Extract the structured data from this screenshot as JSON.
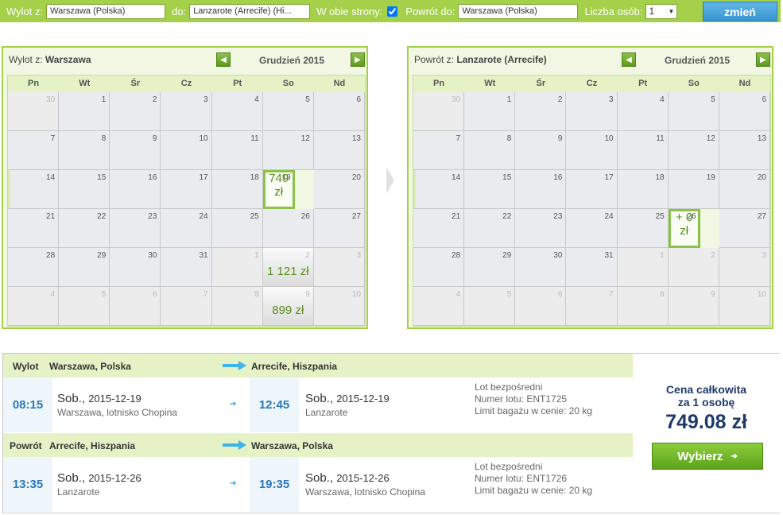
{
  "search": {
    "from_label": "Wylot z:",
    "from_value": "Warszawa (Polska)",
    "to_label": "do:",
    "to_value": "Lanzarote (Arrecife) (Hi...",
    "both_label": "W obie strony:",
    "return_label": "Powrót do:",
    "return_value": "Warszawa (Polska)",
    "people_label": "Liczba osób:",
    "people_value": "1",
    "button": "zmień"
  },
  "calendar_out": {
    "title_prefix": "Wylot z:",
    "title_city": "Warszawa",
    "month": "Grudzień 2015",
    "days": [
      "Pn",
      "Wt",
      "Śr",
      "Cz",
      "Pt",
      "So",
      "Nd"
    ],
    "cells": [
      {
        "d": "30",
        "out": true
      },
      {
        "d": "1"
      },
      {
        "d": "2"
      },
      {
        "d": "3"
      },
      {
        "d": "4"
      },
      {
        "d": "5"
      },
      {
        "d": "6"
      },
      {
        "d": "7"
      },
      {
        "d": "8"
      },
      {
        "d": "9"
      },
      {
        "d": "10"
      },
      {
        "d": "11"
      },
      {
        "d": "12"
      },
      {
        "d": "13"
      },
      {
        "d": "14"
      },
      {
        "d": "15"
      },
      {
        "d": "16"
      },
      {
        "d": "17"
      },
      {
        "d": "18"
      },
      {
        "d": "19",
        "price": "749 zł",
        "sel": true
      },
      {
        "d": "20"
      },
      {
        "d": "21"
      },
      {
        "d": "22"
      },
      {
        "d": "23"
      },
      {
        "d": "24"
      },
      {
        "d": "25"
      },
      {
        "d": "26"
      },
      {
        "d": "27"
      },
      {
        "d": "28"
      },
      {
        "d": "29"
      },
      {
        "d": "30"
      },
      {
        "d": "31"
      },
      {
        "d": "1",
        "out": true
      },
      {
        "d": "2",
        "out": true,
        "price": "1 121 zł",
        "grad": true
      },
      {
        "d": "3",
        "out": true
      },
      {
        "d": "4",
        "out": true
      },
      {
        "d": "5",
        "out": true
      },
      {
        "d": "6",
        "out": true
      },
      {
        "d": "7",
        "out": true
      },
      {
        "d": "8",
        "out": true
      },
      {
        "d": "9",
        "out": true,
        "price": "899 zł",
        "grad": true
      },
      {
        "d": "10",
        "out": true
      }
    ]
  },
  "calendar_ret": {
    "title_prefix": "Powrót z:",
    "title_city": "Lanzarote (Arrecife)",
    "month": "Grudzień 2015",
    "days": [
      "Pn",
      "Wt",
      "Śr",
      "Cz",
      "Pt",
      "So",
      "Nd"
    ],
    "cells": [
      {
        "d": "30",
        "out": true
      },
      {
        "d": "1"
      },
      {
        "d": "2"
      },
      {
        "d": "3"
      },
      {
        "d": "4"
      },
      {
        "d": "5"
      },
      {
        "d": "6"
      },
      {
        "d": "7"
      },
      {
        "d": "8"
      },
      {
        "d": "9"
      },
      {
        "d": "10"
      },
      {
        "d": "11"
      },
      {
        "d": "12"
      },
      {
        "d": "13"
      },
      {
        "d": "14"
      },
      {
        "d": "15"
      },
      {
        "d": "16"
      },
      {
        "d": "17"
      },
      {
        "d": "18"
      },
      {
        "d": "19"
      },
      {
        "d": "20"
      },
      {
        "d": "21"
      },
      {
        "d": "22"
      },
      {
        "d": "23"
      },
      {
        "d": "24"
      },
      {
        "d": "25"
      },
      {
        "d": "26",
        "price": "+ 0 zł",
        "sel": true
      },
      {
        "d": "27"
      },
      {
        "d": "28"
      },
      {
        "d": "29"
      },
      {
        "d": "30"
      },
      {
        "d": "31"
      },
      {
        "d": "1",
        "out": true
      },
      {
        "d": "2",
        "out": true
      },
      {
        "d": "3",
        "out": true
      },
      {
        "d": "4",
        "out": true
      },
      {
        "d": "5",
        "out": true
      },
      {
        "d": "6",
        "out": true
      },
      {
        "d": "7",
        "out": true
      },
      {
        "d": "8",
        "out": true
      },
      {
        "d": "9",
        "out": true
      },
      {
        "d": "10",
        "out": true
      }
    ]
  },
  "outbound": {
    "label": "Wylot",
    "from": "Warszawa, Polska",
    "to": "Arrecife, Hiszpania",
    "dep_time": "08:15",
    "dep_day": "Sob.,",
    "dep_date": "2015-12-19",
    "dep_place": "Warszawa, lotnisko Chopina",
    "arr_time": "12:45",
    "arr_day": "Sob.,",
    "arr_date": "2015-12-19",
    "arr_place": "Lanzarote",
    "info1": "Lot bezpośredni",
    "info2": "Numer lotu: ENT1725",
    "info3": "Limit bagażu w cenie: 20 kg"
  },
  "inbound": {
    "label": "Powrót",
    "from": "Arrecife, Hiszpania",
    "to": "Warszawa, Polska",
    "dep_time": "13:35",
    "dep_day": "Sob.,",
    "dep_date": "2015-12-26",
    "dep_place": "Lanzarote",
    "arr_time": "19:35",
    "arr_day": "Sob.,",
    "arr_date": "2015-12-26",
    "arr_place": "Warszawa, lotnisko Chopina",
    "info1": "Lot bezpośredni",
    "info2": "Numer lotu: ENT1726",
    "info3": "Limit bagażu w cenie: 20 kg"
  },
  "price": {
    "label1": "Cena całkowita",
    "label2": "za 1 osobę",
    "total": "749.08 zł",
    "button": "Wybierz"
  },
  "colors": {
    "accent_green": "#a5d04a",
    "button_blue": "#3a95cf",
    "time_blue": "#2a78b8"
  }
}
